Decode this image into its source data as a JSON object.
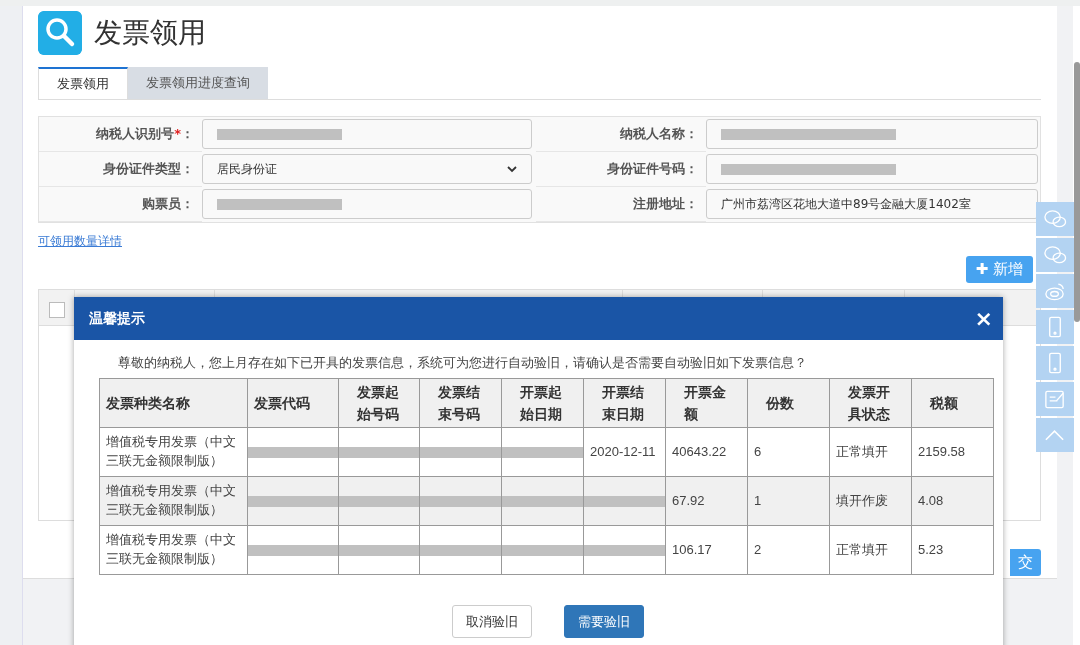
{
  "page": {
    "title": "发票领用"
  },
  "tabs": [
    {
      "label": "发票领用",
      "selected": true
    },
    {
      "label": "发票领用进度查询",
      "selected": false
    }
  ],
  "form": {
    "fields": [
      {
        "label": "纳税人识别号",
        "required_mark": "*",
        "suffix": "：",
        "kind": "redacted"
      },
      {
        "label": "纳税人名称",
        "suffix": "：",
        "kind": "redacted"
      },
      {
        "label": "身份证件类型",
        "suffix": "：",
        "kind": "select",
        "value": "居民身份证"
      },
      {
        "label": "身份证件号码",
        "suffix": "：",
        "kind": "redacted"
      },
      {
        "label": "购票员",
        "suffix": "：",
        "kind": "redacted"
      },
      {
        "label": "注册地址",
        "suffix": "：",
        "kind": "text",
        "value": "广州市荔湾区花地大道中89号金融大厦1402室"
      }
    ]
  },
  "quota_link": "可领用数量详情",
  "list_table": {
    "select_all": {
      "checked": false
    }
  },
  "add_button": {
    "icon": "✚",
    "label": "新增"
  },
  "submit_button": {
    "label": "交"
  },
  "dialog": {
    "title": "温馨提示",
    "close": "×",
    "message": "尊敬的纳税人，您上月存在如下已开具的发票信息，系统可为您进行自动验旧，请确认是否需要自动验旧如下发票信息？",
    "columns": [
      "发票种类名称",
      "发票代码",
      "发票起始号码",
      "发票结束号码",
      "开票起始日期",
      "开票结束日期",
      "开票金额",
      "份数",
      "发票开具状态",
      "税额"
    ],
    "rows": [
      {
        "shaded": false,
        "cells": [
          {
            "kind": "text",
            "text": "增值税专用发票（中文三联无金额限制版）"
          },
          {
            "kind": "redacted"
          },
          {
            "kind": "redacted"
          },
          {
            "kind": "redacted"
          },
          {
            "kind": "redacted"
          },
          {
            "kind": "text",
            "text": "2020-12-11"
          },
          {
            "kind": "text",
            "text": "40643.22"
          },
          {
            "kind": "text",
            "text": "6"
          },
          {
            "kind": "text",
            "text": "正常填开"
          },
          {
            "kind": "text",
            "text": "2159.58"
          }
        ]
      },
      {
        "shaded": true,
        "cells": [
          {
            "kind": "text",
            "text": "增值税专用发票（中文三联无金额限制版）"
          },
          {
            "kind": "redacted"
          },
          {
            "kind": "redacted"
          },
          {
            "kind": "redacted"
          },
          {
            "kind": "redacted"
          },
          {
            "kind": "redacted"
          },
          {
            "kind": "text",
            "text": "67.92"
          },
          {
            "kind": "text",
            "text": "1"
          },
          {
            "kind": "text",
            "text": "填开作废"
          },
          {
            "kind": "text",
            "text": "4.08"
          }
        ]
      },
      {
        "shaded": false,
        "cells": [
          {
            "kind": "text",
            "text": "增值税专用发票（中文三联无金额限制版）"
          },
          {
            "kind": "redacted"
          },
          {
            "kind": "redacted"
          },
          {
            "kind": "redacted"
          },
          {
            "kind": "redacted"
          },
          {
            "kind": "redacted"
          },
          {
            "kind": "text",
            "text": "106.17"
          },
          {
            "kind": "text",
            "text": "2"
          },
          {
            "kind": "text",
            "text": "正常填开"
          },
          {
            "kind": "text",
            "text": "5.23"
          }
        ]
      }
    ],
    "buttons": [
      {
        "label": "取消验旧",
        "kind": "secondary"
      },
      {
        "label": "需要验旧",
        "kind": "primary"
      }
    ]
  }
}
